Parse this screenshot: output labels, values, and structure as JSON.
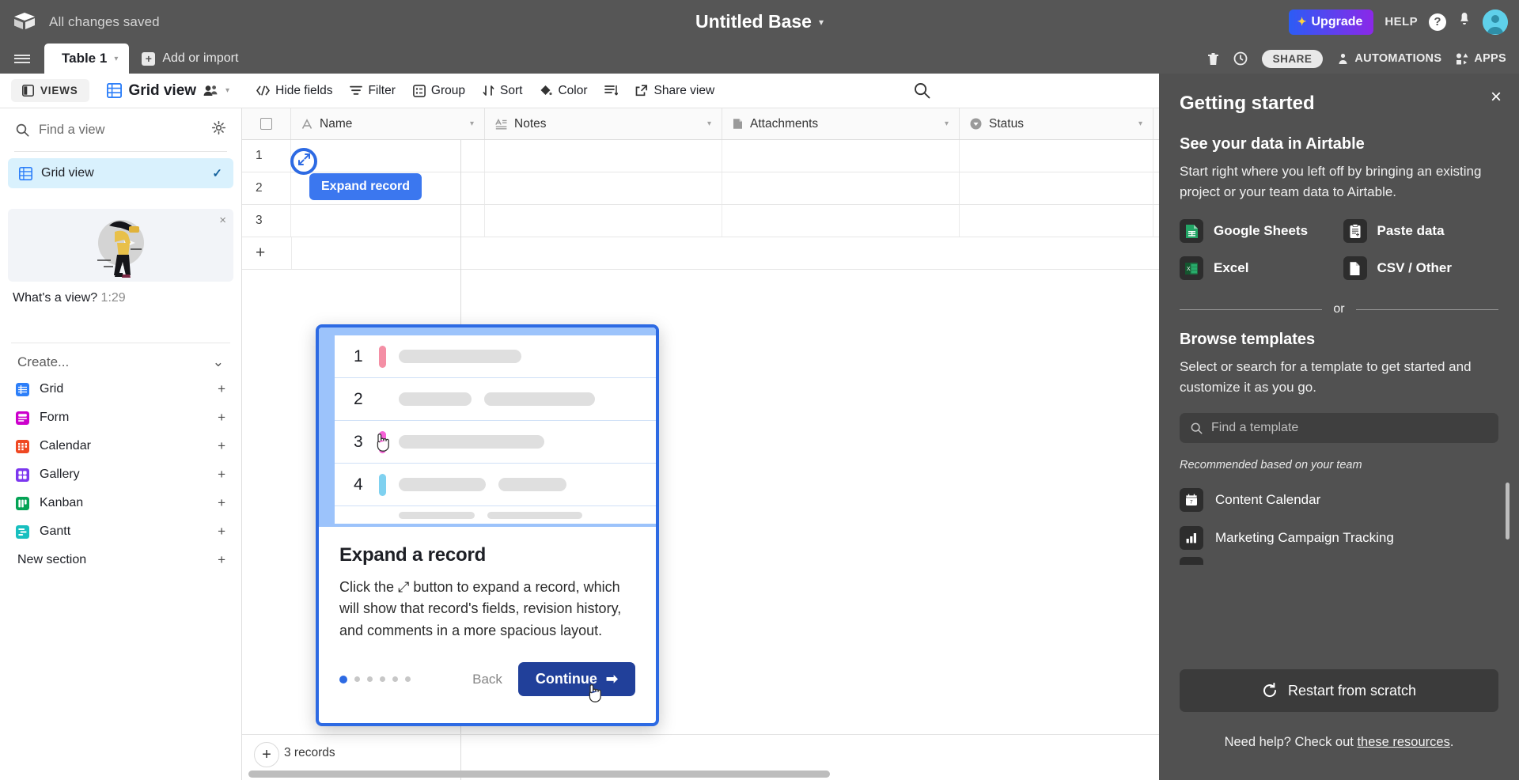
{
  "topbar": {
    "logo_icon": "airtable-logo-icon",
    "saved_status": "All changes saved",
    "base_title": "Untitled Base",
    "base_caret": "▾",
    "upgrade_label": "Upgrade",
    "upgrade_spark": "✦",
    "help_label": "HELP",
    "help_badge": "?",
    "bell_icon": "bell-icon",
    "avatar_icon": "user-avatar"
  },
  "tabsbar": {
    "hamburger_icon": "hamburger-menu-icon",
    "active_tab": "Table 1",
    "tab_caret": "▾",
    "add_or_import": "Add or import",
    "plus_icon": "+",
    "trash_icon": "trash-icon",
    "history_icon": "history-clock-icon",
    "share_label": "SHARE",
    "automations_label": "AUTOMATIONS",
    "apps_label": "APPS"
  },
  "viewbar": {
    "views_label": "VIEWS",
    "views_icon": "sidebar-panel-icon",
    "view_name": "Grid view",
    "view_grid_icon": "grid-icon",
    "collaborators_icon": "collaborators-icon",
    "view_caret": "▾",
    "tools": [
      {
        "label": "Hide fields",
        "icon": "hide-fields-icon"
      },
      {
        "label": "Filter",
        "icon": "filter-icon"
      },
      {
        "label": "Group",
        "icon": "group-icon"
      },
      {
        "label": "Sort",
        "icon": "sort-icon"
      },
      {
        "label": "Color",
        "icon": "color-icon"
      },
      {
        "label": "",
        "icon": "row-height-icon"
      },
      {
        "label": "Share view",
        "icon": "share-view-icon"
      }
    ],
    "search_icon": "search-icon"
  },
  "sidebar": {
    "find_view_placeholder": "Find a view",
    "search_icon": "search-icon",
    "settings_icon": "gear-icon",
    "views": [
      {
        "label": "Grid view",
        "icon": "grid-icon",
        "selected": true,
        "check": "✓"
      }
    ],
    "promo": {
      "close_icon": "×",
      "title": "What's a view?",
      "duration": "1:29",
      "art": "person-with-binoculars-illustration"
    },
    "create": {
      "heading": "Create...",
      "collapse_caret": "⌄",
      "items": [
        {
          "label": "Grid",
          "icon": "grid-view-icon",
          "color": "#2d7ff9",
          "plus": "+"
        },
        {
          "label": "Form",
          "icon": "form-view-icon",
          "color": "#cc00cc",
          "plus": "+"
        },
        {
          "label": "Calendar",
          "icon": "calendar-view-icon",
          "color": "#ef4822",
          "plus": "+"
        },
        {
          "label": "Gallery",
          "icon": "gallery-view-icon",
          "color": "#7c37ef",
          "plus": "+"
        },
        {
          "label": "Kanban",
          "icon": "kanban-view-icon",
          "color": "#04a355",
          "plus": "+"
        },
        {
          "label": "Gantt",
          "icon": "gantt-view-icon",
          "color": "#18bfbf",
          "plus": "+"
        }
      ],
      "new_section": "New section",
      "new_section_plus": "+"
    }
  },
  "grid": {
    "select_all_icon": "checkbox-icon",
    "columns": [
      {
        "label": "Name",
        "type_icon": "text-field-icon"
      },
      {
        "label": "Notes",
        "type_icon": "long-text-field-icon"
      },
      {
        "label": "Attachments",
        "type_icon": "attachment-field-icon"
      },
      {
        "label": "Status",
        "type_icon": "single-select-field-icon"
      }
    ],
    "rows": [
      {
        "num": "1",
        "name": "",
        "notes": "",
        "attachments": "",
        "status": ""
      },
      {
        "num": "2",
        "name": "",
        "notes": "",
        "attachments": "",
        "status": ""
      },
      {
        "num": "3",
        "name": "",
        "notes": "",
        "attachments": "",
        "status": ""
      }
    ],
    "add_row_icon": "+",
    "expand_button_icon": "expand-record-icon",
    "expand_tooltip": "Expand record",
    "records_count": "3 records",
    "add_record_fab": "+"
  },
  "onboarding": {
    "title": "Expand a record",
    "body": "Click the ⤢ button to expand a record, which will show that record's fields, revision history, and comments in a more spacious layout.",
    "back_label": "Back",
    "continue_label": "Continue",
    "continue_arrow": "➡",
    "dots_total": 6,
    "dots_active_index": 0,
    "preview_rows": [
      {
        "num": "1",
        "bar_color": "#f48fa5"
      },
      {
        "num": "2",
        "bar_color": ""
      },
      {
        "num": "3",
        "bar_color": "#f562d6"
      },
      {
        "num": "4",
        "bar_color": "#7fd1f0"
      }
    ],
    "cursor_icon": "hand-cursor-icon"
  },
  "right_panel": {
    "close_icon": "×",
    "title": "Getting started",
    "section1_title": "See your data in Airtable",
    "section1_text": "Start right where you left off by bringing an existing project or your team data to Airtable.",
    "imports": [
      {
        "label": "Google Sheets",
        "icon": "google-sheets-icon",
        "color": "#23a566"
      },
      {
        "label": "Paste data",
        "icon": "paste-data-icon",
        "color": "#ffffff"
      },
      {
        "label": "Excel",
        "icon": "excel-icon",
        "color": "#1d6f42"
      },
      {
        "label": "CSV / Other",
        "icon": "csv-file-icon",
        "color": "#ffffff"
      }
    ],
    "or_text": "or",
    "section2_title": "Browse templates",
    "section2_text": "Select or search for a template to get started and customize it as you go.",
    "template_search_placeholder": "Find a template",
    "template_search_icon": "search-icon",
    "recommended_label": "Recommended based on your team",
    "templates": [
      {
        "label": "Content Calendar",
        "icon": "calendar-template-icon"
      },
      {
        "label": "Marketing Campaign Tracking",
        "icon": "bar-chart-template-icon"
      }
    ],
    "restart_label": "Restart from scratch",
    "restart_icon": "restart-icon",
    "need_help_prefix": "Need help? Check out ",
    "need_help_link": "these resources",
    "need_help_suffix": "."
  },
  "colors": {
    "chrome": "#565656",
    "accent_blue": "#2d6ae3",
    "panel_dark": "#515151",
    "selected_view": "#d9f1fd"
  }
}
